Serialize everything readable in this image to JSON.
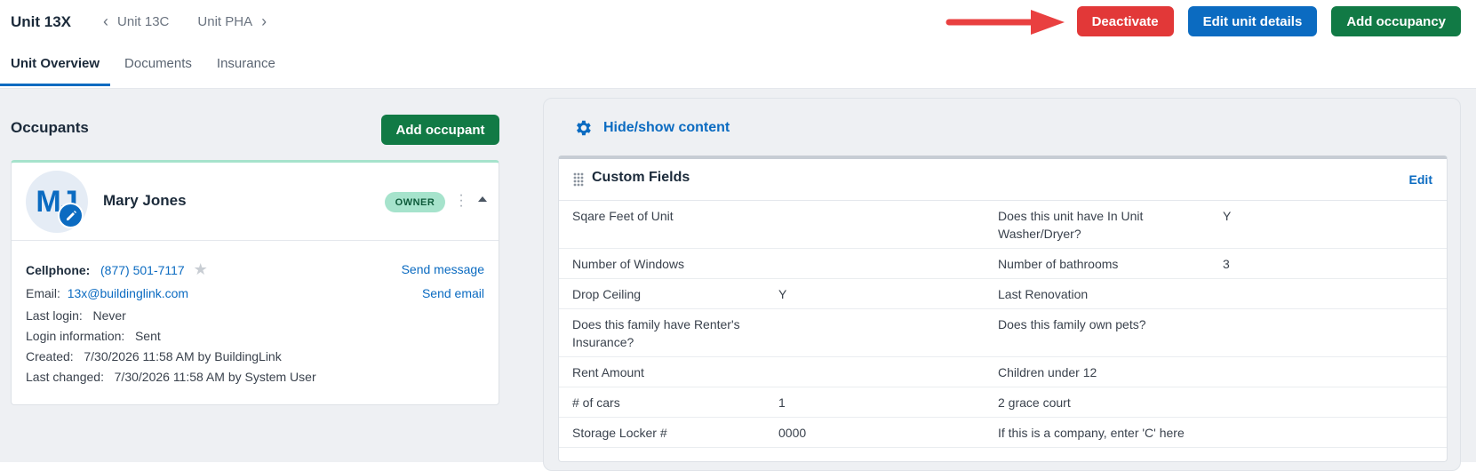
{
  "header": {
    "unit_title": "Unit 13X",
    "prev_unit": "Unit 13C",
    "next_unit": "Unit PHA",
    "actions": {
      "deactivate": "Deactivate",
      "edit_details": "Edit unit details",
      "add_occupancy": "Add occupancy"
    },
    "tabs": [
      "Unit Overview",
      "Documents",
      "Insurance"
    ]
  },
  "occupants": {
    "heading": "Occupants",
    "add_button": "Add occupant",
    "card": {
      "initials": "MJ",
      "name": "Mary Jones",
      "badge": "OWNER",
      "cellphone_label": "Cellphone:",
      "cellphone": "(877) 501-7117",
      "email_label": "Email:",
      "email": "13x@buildinglink.com",
      "last_login_label": "Last login:",
      "last_login": "Never",
      "login_info_label": "Login information:",
      "login_info": "Sent",
      "created_label": "Created:",
      "created": "7/30/2026 11:58 AM by BuildingLink",
      "changed_label": "Last changed:",
      "changed": "7/30/2026 11:58 AM by System User",
      "send_message": "Send message",
      "send_email": "Send email"
    }
  },
  "custom_fields": {
    "hide_show": "Hide/show content",
    "title": "Custom Fields",
    "edit": "Edit",
    "rows": [
      {
        "l1": "Sqare Feet of Unit",
        "v1": "",
        "l2": "Does this unit have In Unit Washer/Dryer?",
        "v2": "Y"
      },
      {
        "l1": "Number of Windows",
        "v1": "",
        "l2": "Number of bathrooms",
        "v2": "3"
      },
      {
        "l1": "Drop Ceiling",
        "v1": "Y",
        "l2": "Last Renovation",
        "v2": ""
      },
      {
        "l1": "Does this family have Renter's Insurance?",
        "v1": "",
        "l2": "Does this family own pets?",
        "v2": ""
      },
      {
        "l1": "Rent Amount",
        "v1": "",
        "l2": "Children under 12",
        "v2": ""
      },
      {
        "l1": "# of cars",
        "v1": "1",
        "l2": "2 grace court",
        "v2": ""
      },
      {
        "l1": "Storage Locker #",
        "v1": "0000",
        "l2": "If this is a company, enter 'C' here",
        "v2": ""
      }
    ]
  },
  "colors": {
    "accent_blue": "#0b6bc1",
    "danger_red": "#e23838",
    "success_green": "#117a45",
    "owner_badge": "#a6e3cc",
    "annotation_arrow": "#e94040"
  }
}
